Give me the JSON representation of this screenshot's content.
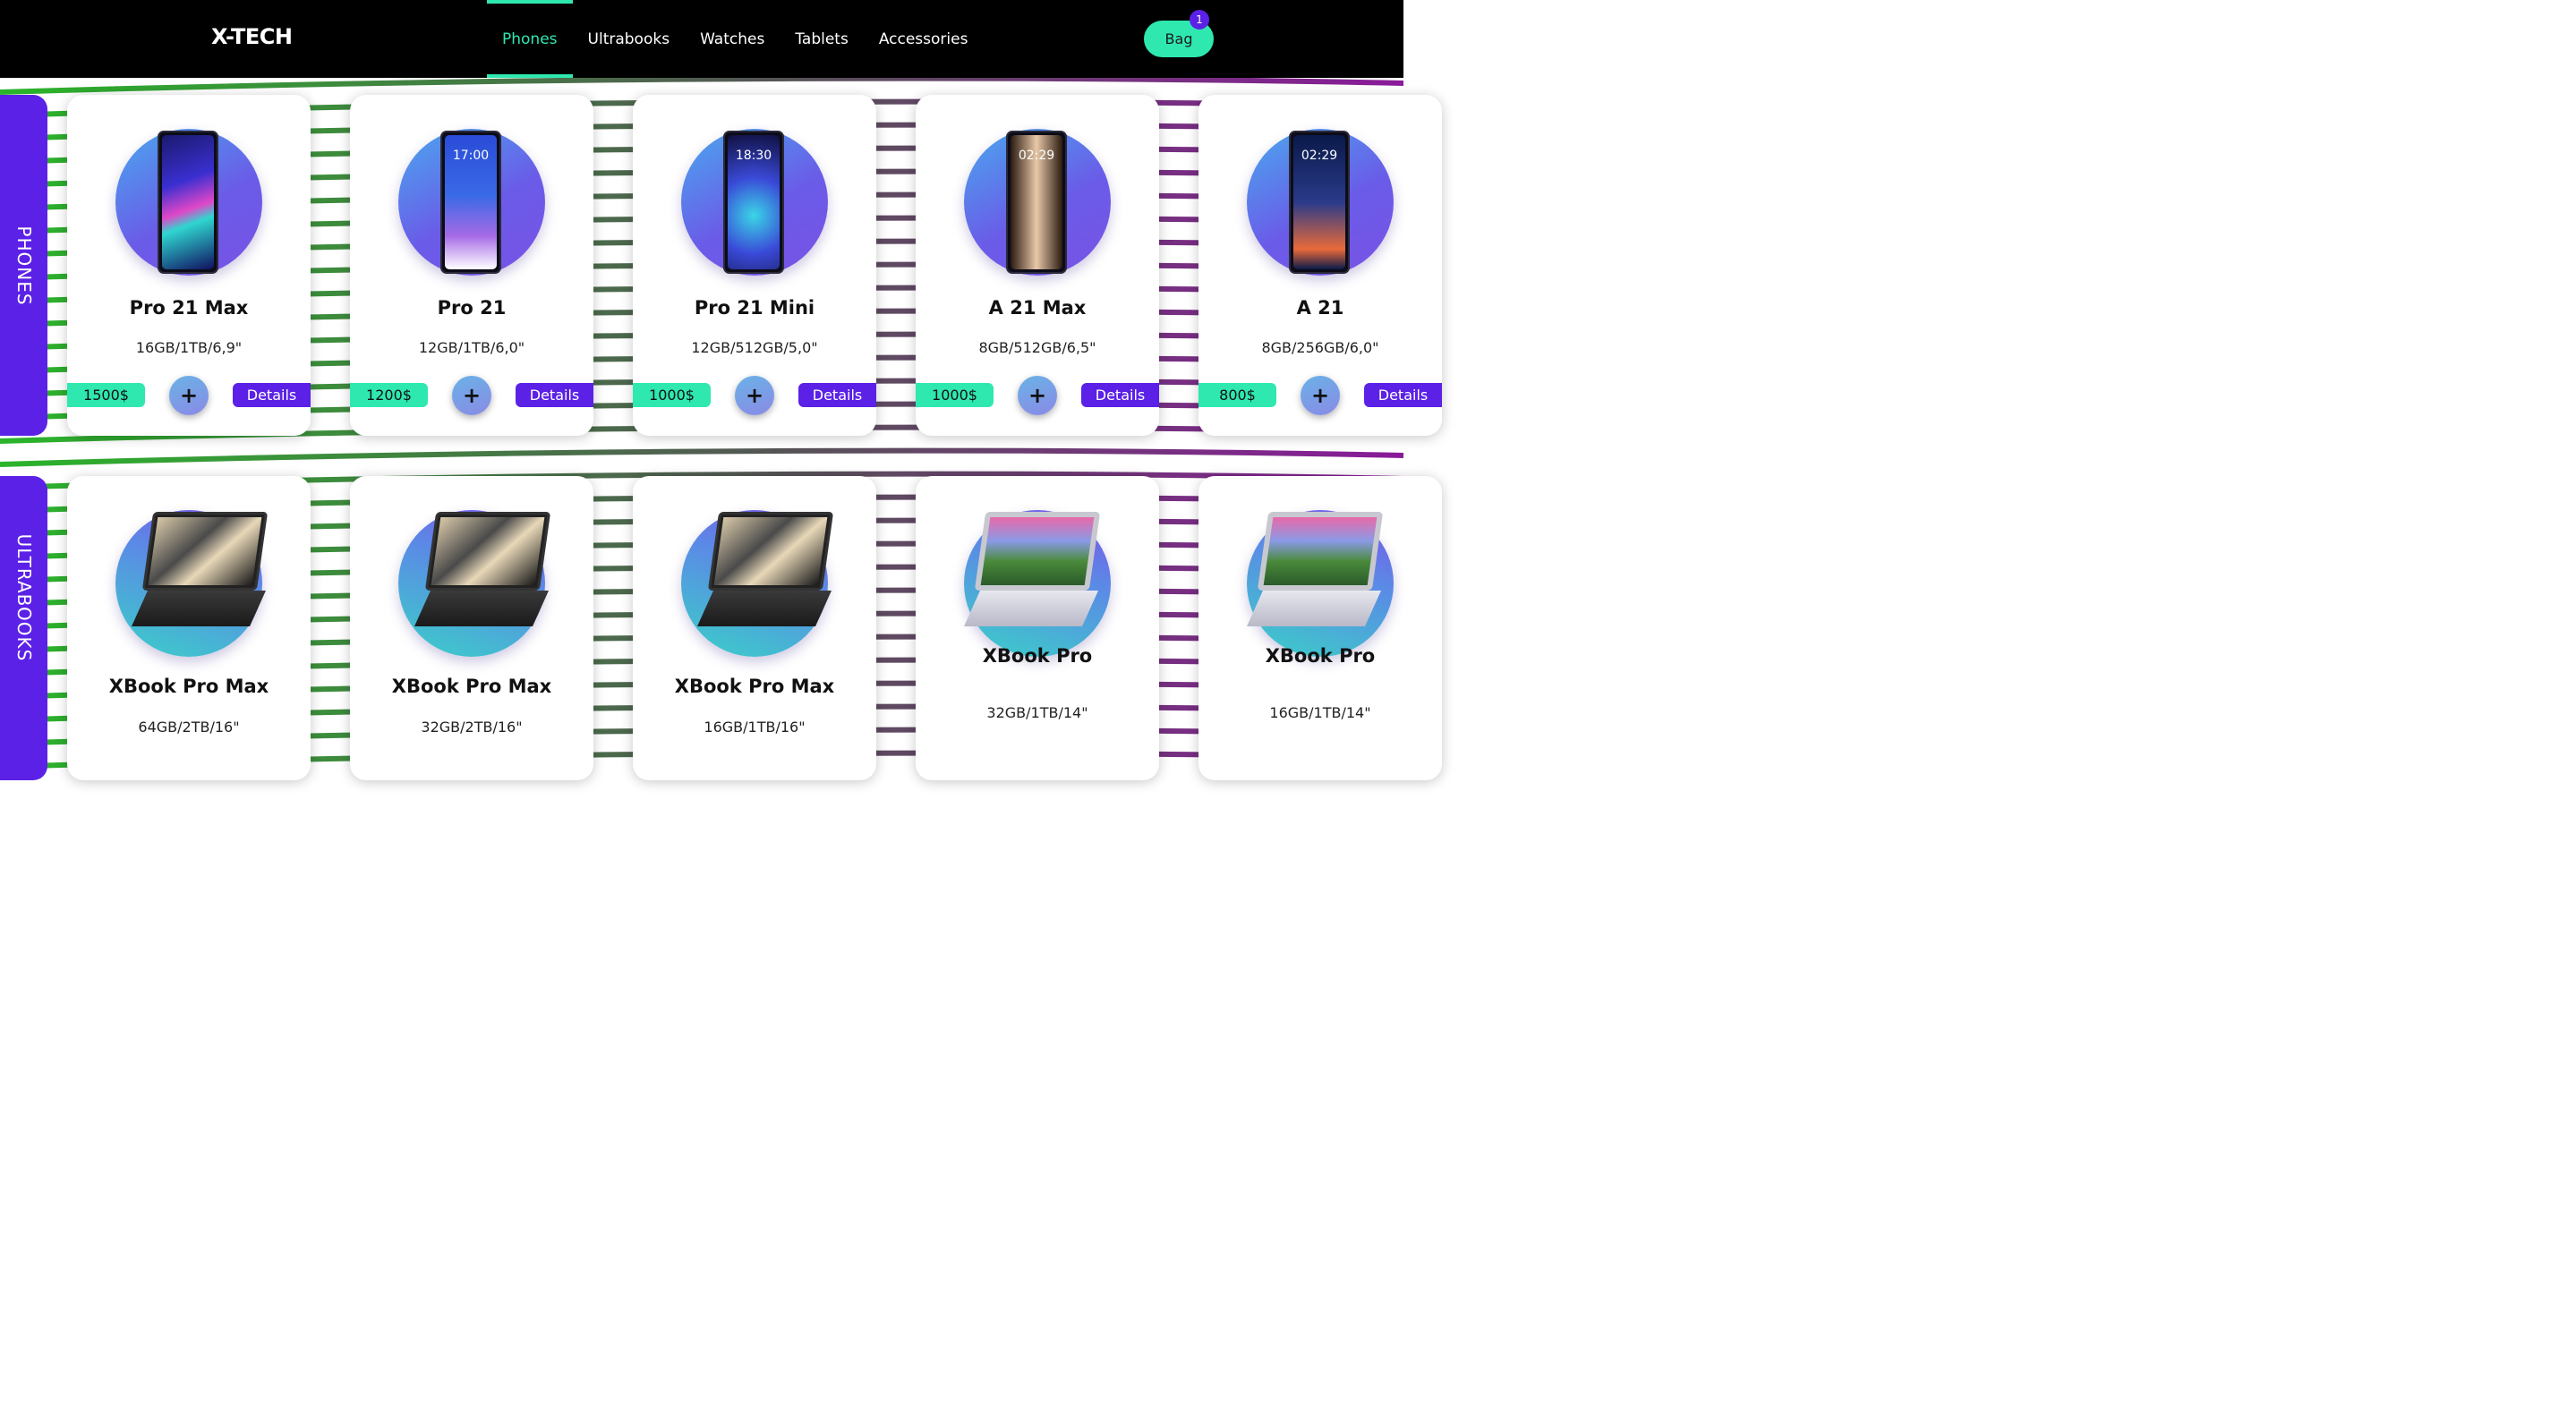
{
  "header": {
    "logo": "X-TECH",
    "nav": [
      "Phones",
      "Ultrabooks",
      "Watches",
      "Tablets",
      "Accessories"
    ],
    "active_nav": "Phones",
    "bag_label": "Bag",
    "bag_count": "1"
  },
  "colors": {
    "accent": "#2ee8b0",
    "brand": "#5b21e6",
    "header_bg": "#000000"
  },
  "sections": {
    "phones": {
      "label": "PHONES",
      "products": [
        {
          "name": "Pro 21 Max",
          "spec": "16GB/1TB/6,9\"",
          "price": "1500$",
          "add": "+",
          "details": "Details"
        },
        {
          "name": "Pro 21",
          "spec": "12GB/1TB/6,0\"",
          "price": "1200$",
          "add": "+",
          "details": "Details",
          "clock": "17:00"
        },
        {
          "name": "Pro 21 Mini",
          "spec": "12GB/512GB/5,0\"",
          "price": "1000$",
          "add": "+",
          "details": "Details",
          "clock": "18:30"
        },
        {
          "name": "A 21 Max",
          "spec": "8GB/512GB/6,5\"",
          "price": "1000$",
          "add": "+",
          "details": "Details",
          "clock": "02:29"
        },
        {
          "name": "A 21",
          "spec": "8GB/256GB/6,0\"",
          "price": "800$",
          "add": "+",
          "details": "Details",
          "clock": "02:29"
        }
      ]
    },
    "ultrabooks": {
      "label": "ULTRABOOKS",
      "products": [
        {
          "name": "XBook Pro Max",
          "spec": "64GB/2TB/16\""
        },
        {
          "name": "XBook Pro Max",
          "spec": "32GB/2TB/16\""
        },
        {
          "name": "XBook Pro Max",
          "spec": "16GB/1TB/16\""
        },
        {
          "name": "XBook Pro",
          "spec": "32GB/1TB/14\""
        },
        {
          "name": "XBook Pro",
          "spec": "16GB/1TB/14\""
        }
      ]
    }
  }
}
